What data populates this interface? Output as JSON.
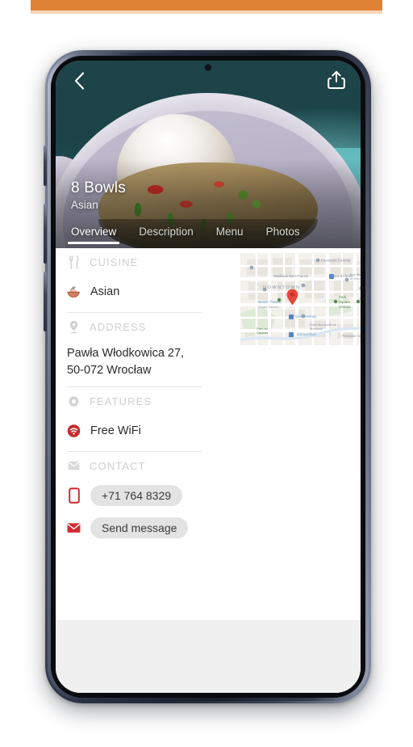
{
  "banner": {
    "color": "#e08235"
  },
  "phone": {
    "buttons": [
      "power-button",
      "volume-up-button",
      "volume-down-button"
    ]
  },
  "hero": {
    "back_icon": "chevron-left-icon",
    "share_icon": "share-icon",
    "venue_name": "8 Bowls",
    "venue_subtitle": "Asian",
    "teal_color": "#1d4549",
    "accent_white": "#ffffff"
  },
  "tabs": [
    {
      "label": "Overview",
      "active": true
    },
    {
      "label": "Description",
      "active": false
    },
    {
      "label": "Menu",
      "active": false
    },
    {
      "label": "Photos",
      "active": false
    }
  ],
  "sections": {
    "cuisine": {
      "label": "CUISINE",
      "icon": "cutlery-icon",
      "value": "Asian",
      "value_icon": "rice-bowl-icon"
    },
    "address": {
      "label": "ADDRESS",
      "icon": "location-pin-icon",
      "line1": "Pawła Włodkowica 27,",
      "line2": "50-072 Wrocław"
    },
    "features": {
      "label": "FEATURES",
      "icon": "gear-icon",
      "value": "Free WiFi",
      "value_icon": "wifi-icon",
      "value_icon_color": "#cc2222"
    },
    "contact": {
      "label": "CONTACT",
      "icon": "envelope-icon",
      "phone": "+71 764 8329",
      "phone_icon": "mobile-phone-icon",
      "message_label": "Send message",
      "message_icon": "envelope-icon",
      "icon_color": "#d02c2c"
    }
  },
  "map": {
    "area_label": "DOWNTOWN",
    "marker": "map-marker-pin",
    "marker_color": "#e8453c",
    "pois": [
      "Passeport Canada",
      "Place-d'Armes",
      "Basilique Saint-Patrick",
      "Park Square",
      "Gare Centrale",
      "Monde Theatre",
      "Bnc Banque de Montreal"
    ]
  }
}
